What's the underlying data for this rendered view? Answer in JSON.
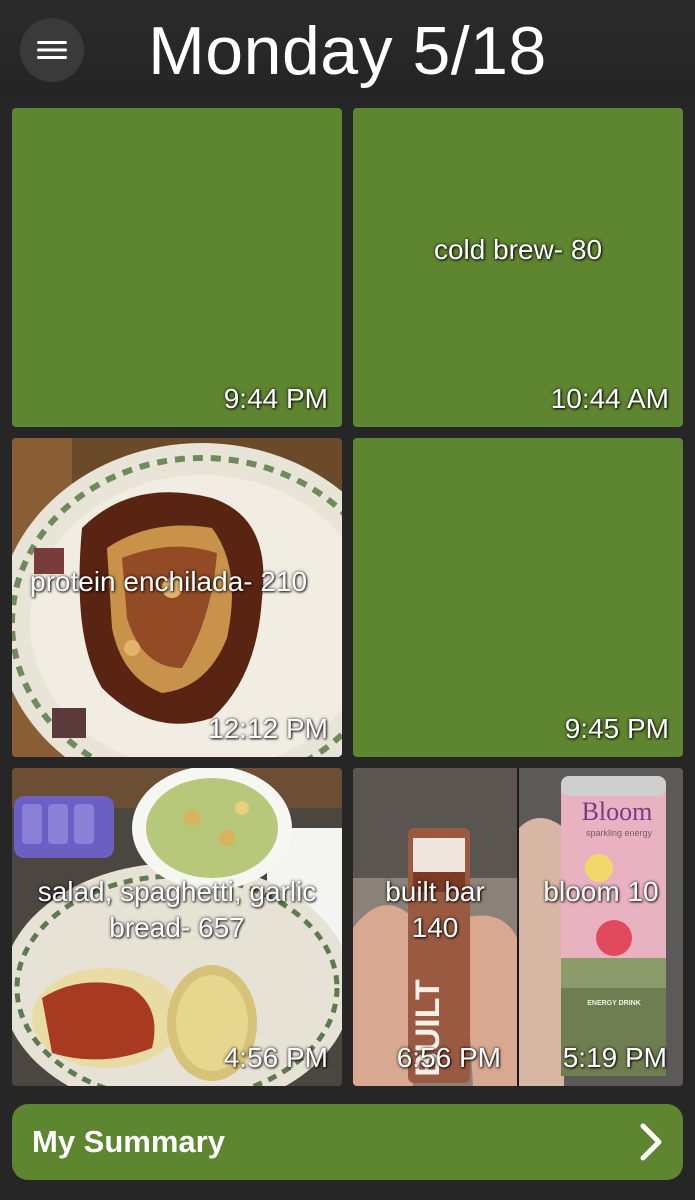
{
  "header": {
    "title": "Monday 5/18",
    "menu_icon": "hamburger-menu-icon"
  },
  "colors": {
    "background": "#262626",
    "tile_green": "#5e8530",
    "summary_green": "#5e8530",
    "text": "#ffffff"
  },
  "tiles": [
    {
      "caption": "",
      "time": "9:44 PM",
      "kind": "color"
    },
    {
      "caption": "cold brew- 80",
      "time": "10:44 AM",
      "kind": "color"
    },
    {
      "caption": "protein enchilada- 210",
      "time": "12:12 PM",
      "kind": "photo"
    },
    {
      "caption": "",
      "time": "9:45 PM",
      "kind": "color"
    },
    {
      "caption": "salad, spaghetti, garlic bread- 657",
      "time": "4:56 PM",
      "kind": "photo"
    },
    {
      "caption": "built bar 140",
      "time": "6:56 PM",
      "kind": "photo"
    },
    {
      "caption": "bloom 10",
      "time": "5:19 PM",
      "kind": "photo"
    }
  ],
  "photo_text": {
    "built_wrapper": "BUILT",
    "bloom_brand": "Bloom",
    "bloom_sub": "sparkling energy",
    "bloom_drink": "ENERGY DRINK"
  },
  "summary": {
    "label": "My Summary",
    "icon": "chevron-right-icon"
  }
}
